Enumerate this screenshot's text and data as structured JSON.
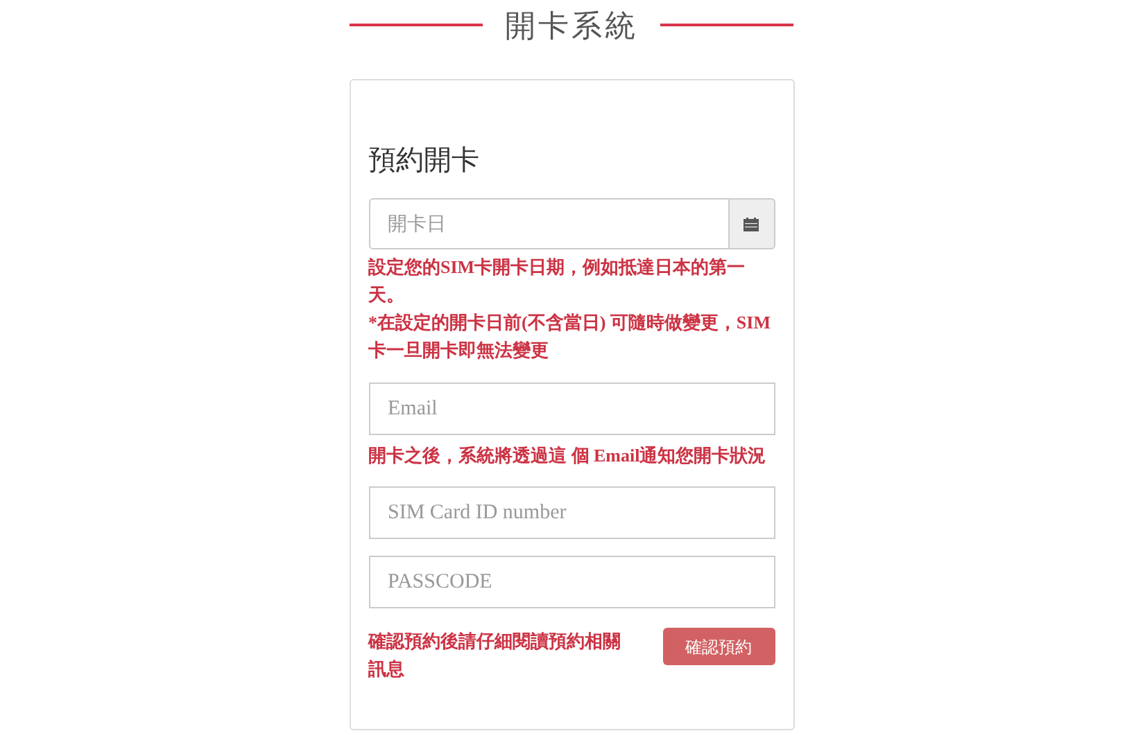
{
  "page_title": "開卡系統",
  "form": {
    "heading": "預約開卡",
    "date_field": {
      "placeholder": "開卡日"
    },
    "date_notes": [
      "設定您的SIM卡開卡日期，例如抵達日本的第一天。",
      "*在設定的開卡日前(不含當日) 可隨時做變更，SIM卡一旦開卡即無法變更"
    ],
    "email_field": {
      "placeholder": "Email"
    },
    "email_note": "開卡之後，系統將透過這 個 Email通知您開卡狀況",
    "sim_field": {
      "placeholder": "SIM Card ID number"
    },
    "passcode_field": {
      "placeholder": "PASSCODE"
    },
    "footer_note": "確認預約後請仔細閱讀預約相關訊息",
    "submit_button": "確認預約"
  }
}
